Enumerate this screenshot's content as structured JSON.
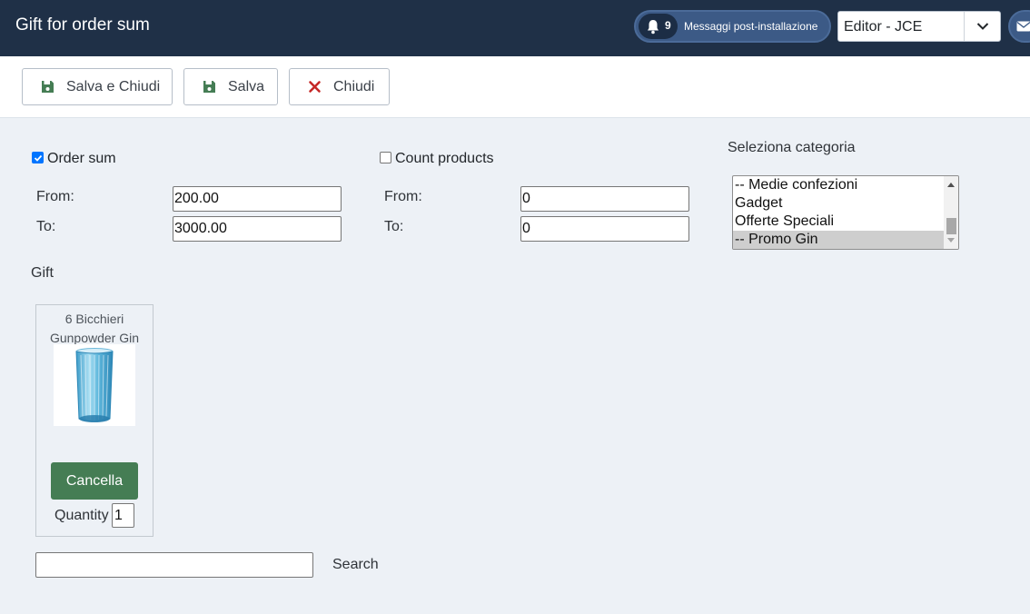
{
  "header": {
    "title": "Gift for order sum",
    "notifications": {
      "count": "9",
      "label": "Messaggi post-installazione"
    },
    "editor_select": {
      "value": "Editor - JCE"
    }
  },
  "toolbar": {
    "save_close_label": "Salva e Chiudi",
    "save_label": "Salva",
    "close_label": "Chiudi"
  },
  "order_sum": {
    "label": "Order sum",
    "checked": true,
    "from_label": "From:",
    "from_value": "200.00",
    "to_label": "To:",
    "to_value": "3000.00"
  },
  "count_products": {
    "label": "Count products",
    "checked": false,
    "from_label": "From:",
    "from_value": "0",
    "to_label": "To:",
    "to_value": "0"
  },
  "category": {
    "label": "Seleziona categoria",
    "options": [
      "-- Medie confezioni",
      "Gadget",
      "Offerte Speciali",
      "-- Promo Gin"
    ],
    "selected": "-- Promo Gin"
  },
  "gift": {
    "label": "Gift",
    "item": {
      "name": "6 Bicchieri Gunpowder Gin",
      "cancel_label": "Cancella",
      "quantity_label": "Quantity",
      "quantity_value": "1"
    }
  },
  "search": {
    "value": "",
    "button_label": "Search"
  },
  "colors": {
    "header_bg": "#1f3047",
    "page_bg": "#edf1f6",
    "cancel_bg": "#457d54",
    "save_icon": "#457d54",
    "close_icon": "#c52827",
    "checkbox_accent": "#0075ff"
  },
  "icons": {
    "notification": "bell-icon",
    "editor_dropdown": "chevron-down-icon",
    "mail": "mail-icon",
    "save_close": "floppy-disk-icon",
    "save": "floppy-disk-icon",
    "close": "x-icon"
  }
}
